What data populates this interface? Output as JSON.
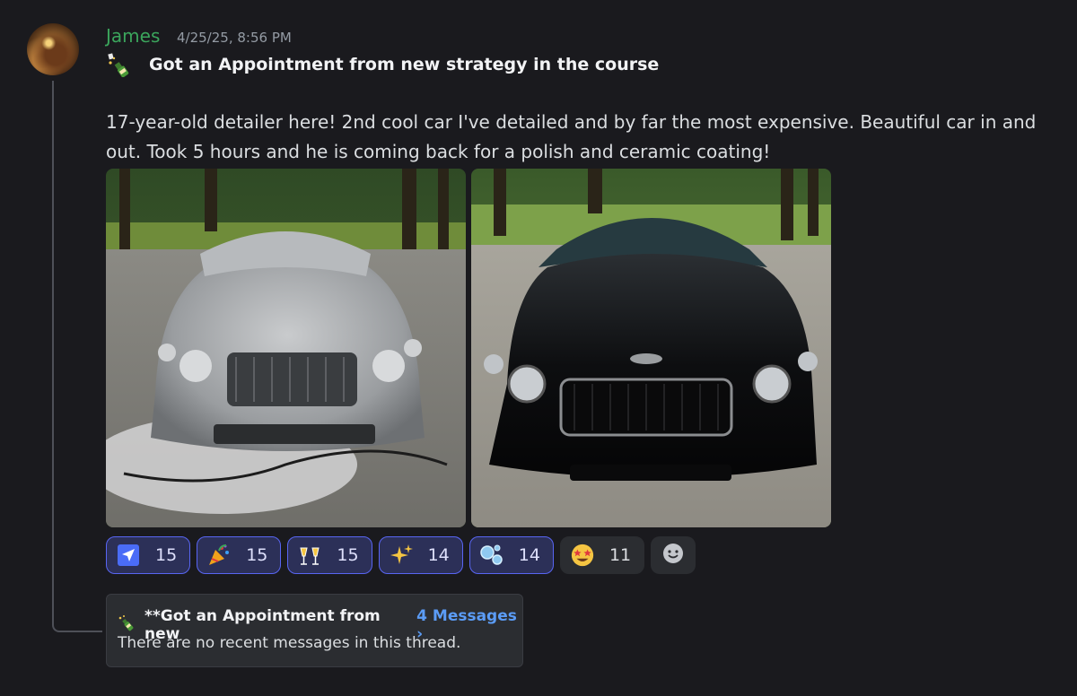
{
  "message": {
    "author": "James",
    "author_color": "#3ba55c",
    "timestamp": "4/25/25, 8:56 PM",
    "title_icon": "champagne-bottle-icon",
    "title": "Got an Appointment from new strategy in the course",
    "body": "17-year-old detailer here! 2nd cool car I've detailed and by far the most expensive. Beautiful car in and out. Took 5 hours and he is coming back for a polish and ceramic coating!",
    "attachments": [
      {
        "icon": "photo-foam-covered-car"
      },
      {
        "icon": "photo-clean-black-car"
      }
    ]
  },
  "reactions": [
    {
      "icon": "paper-plane-icon",
      "count": "15",
      "active": true
    },
    {
      "icon": "party-popper-icon",
      "count": "15",
      "active": true
    },
    {
      "icon": "champagne-glasses-icon",
      "count": "15",
      "active": true
    },
    {
      "icon": "sparkles-icon",
      "count": "14",
      "active": true
    },
    {
      "icon": "bubbles-icon",
      "count": "14",
      "active": true
    },
    {
      "icon": "star-struck-face-icon",
      "count": "11",
      "active": false
    }
  ],
  "add_reaction_icon": "add-reaction-smiley-icon",
  "thread": {
    "icon": "champagne-bottle-icon",
    "name": "**Got an Appointment from new",
    "count_label": "4 Messages ›",
    "empty_text": "There are no recent messages in this thread."
  },
  "colors": {
    "background": "#1a1a1e",
    "accent": "#5865f2",
    "link": "#5b9cf6"
  }
}
